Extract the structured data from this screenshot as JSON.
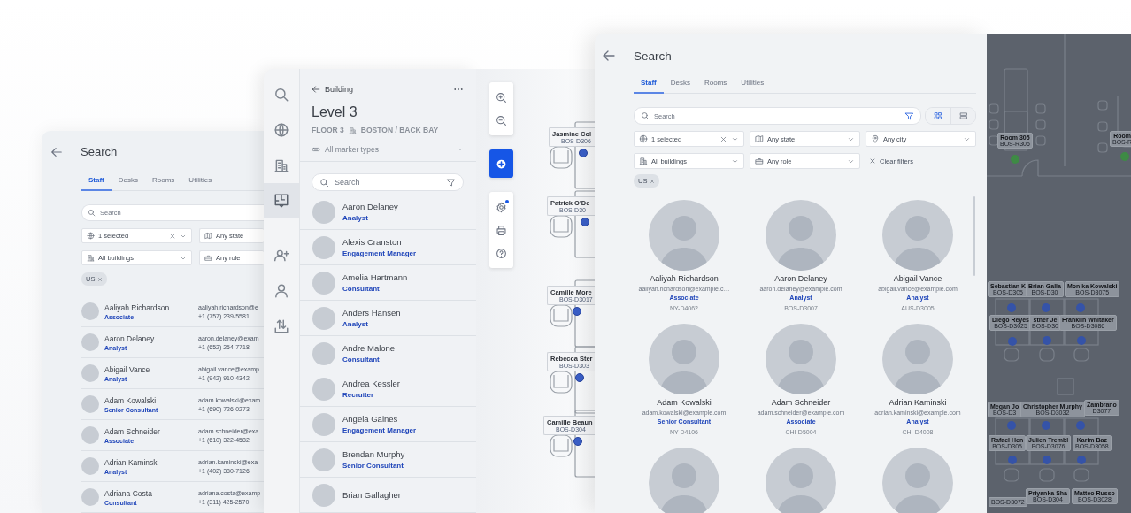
{
  "back_panel": {
    "title": "Search",
    "tabs": [
      {
        "label": "Staff",
        "selected": true
      },
      {
        "label": "Desks",
        "selected": false
      },
      {
        "label": "Rooms",
        "selected": false
      },
      {
        "label": "Utilities",
        "selected": false
      }
    ],
    "search": {
      "placeholder": "Search"
    },
    "filters": [
      {
        "kind": "region",
        "value": "1 selected",
        "clearable": true
      },
      {
        "kind": "state",
        "value": "Any state",
        "clearable": false
      },
      {
        "kind": "building",
        "value": "All buildings",
        "clearable": false
      },
      {
        "kind": "role",
        "value": "Any role",
        "clearable": false
      }
    ],
    "chips": [
      "US"
    ],
    "people": [
      {
        "name": "Aaliyah Richardson",
        "role": "Associate",
        "email": "aaliyah.richardson@e",
        "phone": "+1 (757) 239-5581"
      },
      {
        "name": "Aaron Delaney",
        "role": "Analyst",
        "email": "aaron.delaney@exam",
        "phone": "+1 (652) 254-7718"
      },
      {
        "name": "Abigail Vance",
        "role": "Analyst",
        "email": "abigail.vance@examp",
        "phone": "+1 (942) 910-4342"
      },
      {
        "name": "Adam Kowalski",
        "role": "Senior Consultant",
        "email": "adam.kowalski@exam",
        "phone": "+1 (690) 726-0273"
      },
      {
        "name": "Adam Schneider",
        "role": "Associate",
        "email": "adam.schneider@exa",
        "phone": "+1 (610) 322-4582"
      },
      {
        "name": "Adrian Kaminski",
        "role": "Analyst",
        "email": "adrian.kaminski@exa",
        "phone": "+1 (402) 380-7126"
      },
      {
        "name": "Adriana Costa",
        "role": "Consultant",
        "email": "adriana.costa@examp",
        "phone": "+1 (311) 425-2570"
      }
    ]
  },
  "floor_panel": {
    "rail": [
      {
        "kind": "search",
        "selected": false
      },
      {
        "kind": "globe",
        "selected": false
      },
      {
        "kind": "building",
        "selected": false
      },
      {
        "kind": "floorplan",
        "selected": true
      },
      {
        "kind": "adduser",
        "selected": false
      },
      {
        "kind": "user",
        "selected": false
      },
      {
        "kind": "transfer",
        "selected": false
      }
    ],
    "back_label": "Building",
    "title": "Level 3",
    "floor": "FLOOR 3",
    "location": "BOSTON / BACK BAY",
    "marker_filter": "All marker types",
    "search": {
      "placeholder": "Search"
    },
    "people": [
      {
        "name": "Aaron Delaney",
        "role": "Analyst"
      },
      {
        "name": "Alexis Cranston",
        "role": "Engagement Manager"
      },
      {
        "name": "Amelia Hartmann",
        "role": "Consultant"
      },
      {
        "name": "Anders Hansen",
        "role": "Analyst"
      },
      {
        "name": "Andre Malone",
        "role": "Consultant"
      },
      {
        "name": "Andrea Kessler",
        "role": "Recruiter"
      },
      {
        "name": "Angela Gaines",
        "role": "Engagement Manager"
      },
      {
        "name": "Brendan Murphy",
        "role": "Senior Consultant"
      },
      {
        "name": "Brian Gallagher"
      }
    ]
  },
  "floor_map": {
    "tools": [
      [
        {
          "kind": "zoomin",
          "badge": false
        },
        {
          "kind": "zoomout",
          "badge": false
        }
      ],
      [
        {
          "kind": "add",
          "badge": false
        }
      ],
      [
        {
          "kind": "settings",
          "badge": true
        },
        {
          "kind": "print",
          "badge": false
        },
        {
          "kind": "help",
          "badge": false
        }
      ]
    ],
    "desks": [
      {
        "name": "Jasmine Col",
        "code": "BOS-D306"
      },
      {
        "name": "Patrick O'De",
        "code": "BOS-D30"
      },
      {
        "name": "Camille More",
        "code": "BOS-D3017"
      },
      {
        "name": "Rebecca Ster",
        "code": "BOS-D303"
      },
      {
        "name": "Camille Beaun",
        "code": "BOS-D304"
      }
    ]
  },
  "search_panel": {
    "title": "Search",
    "tabs": [
      {
        "label": "Staff",
        "selected": true
      },
      {
        "label": "Desks",
        "selected": false
      },
      {
        "label": "Rooms",
        "selected": false
      },
      {
        "label": "Utilities",
        "selected": false
      }
    ],
    "search": {
      "placeholder": "Search"
    },
    "views": [
      {
        "kind": "grid",
        "selected": true
      },
      {
        "kind": "list",
        "selected": false
      }
    ],
    "filters": [
      {
        "kind": "region",
        "value": "1 selected",
        "clearable": true
      },
      {
        "kind": "state",
        "value": "Any state",
        "clearable": false
      },
      {
        "kind": "city",
        "value": "Any city",
        "clearable": false
      },
      {
        "kind": "building",
        "value": "All buildings",
        "clearable": false
      },
      {
        "kind": "role",
        "value": "Any role",
        "clearable": false
      }
    ],
    "clear_filters": "Clear filters",
    "chips": [
      "US"
    ],
    "people": [
      {
        "name": "Aaliyah Richardson",
        "email": "aaliyah.richardson@example.c…",
        "role": "Associate",
        "desk": "NY-D4062"
      },
      {
        "name": "Aaron Delaney",
        "email": "aaron.delaney@example.com",
        "role": "Analyst",
        "desk": "BOS-D3007"
      },
      {
        "name": "Abigail Vance",
        "email": "abigail.vance@example.com",
        "role": "Analyst",
        "desk": "AUS-D3005"
      },
      {
        "name": "Adam Kowalski",
        "email": "adam.kowalski@example.com",
        "role": "Senior Consultant",
        "desk": "NY-D4106"
      },
      {
        "name": "Adam Schneider",
        "email": "adam.schneider@example.com",
        "role": "Associate",
        "desk": "CHI-D5004"
      },
      {
        "name": "Adrian Kaminski",
        "email": "adrian.kaminski@example.com",
        "role": "Analyst",
        "desk": "CHI-D4008"
      }
    ]
  },
  "overview_map": {
    "markers": [
      {
        "kind": "room",
        "name": "Room 305",
        "code": "BOS-R305"
      },
      {
        "kind": "room",
        "name": "Room",
        "code": "BOS-R"
      },
      {
        "kind": "desk",
        "name": "Sebastian K",
        "code": "BOS-D305"
      },
      {
        "kind": "desk",
        "name": "Brian Galla",
        "code": "BOS-D30"
      },
      {
        "kind": "desk",
        "name": "Monika Kowalski",
        "code": "BOS-D3075"
      },
      {
        "kind": "desk",
        "name": "Diego Reyes",
        "code": "BOS-D3025"
      },
      {
        "kind": "desk",
        "name": "sther Je",
        "code": "BOS-D30"
      },
      {
        "kind": "desk",
        "name": "Franklin Whitaker",
        "code": "BOS-D3086"
      },
      {
        "kind": "desk",
        "name": "Megan Jo",
        "code": "BOS-D3"
      },
      {
        "kind": "desk",
        "name": "Christopher Murphy",
        "code": "BOS-D3032"
      },
      {
        "kind": "desk",
        "name": "Zambrano",
        "code": "D3077"
      },
      {
        "kind": "desk",
        "name": "Rafael Hen",
        "code": "BOS-D305"
      },
      {
        "kind": "desk",
        "name": "Julien Trembl",
        "code": "BOS-D3076"
      },
      {
        "kind": "desk",
        "name": "Karim Baz",
        "code": "BOS-D3058"
      },
      {
        "kind": "desk",
        "code": "BOS-D3072"
      },
      {
        "kind": "desk",
        "name": "Priyanka Sha",
        "code": "BOS-D304"
      },
      {
        "kind": "desk",
        "name": "Matteo Russo",
        "code": "BOS-D3028"
      }
    ]
  }
}
